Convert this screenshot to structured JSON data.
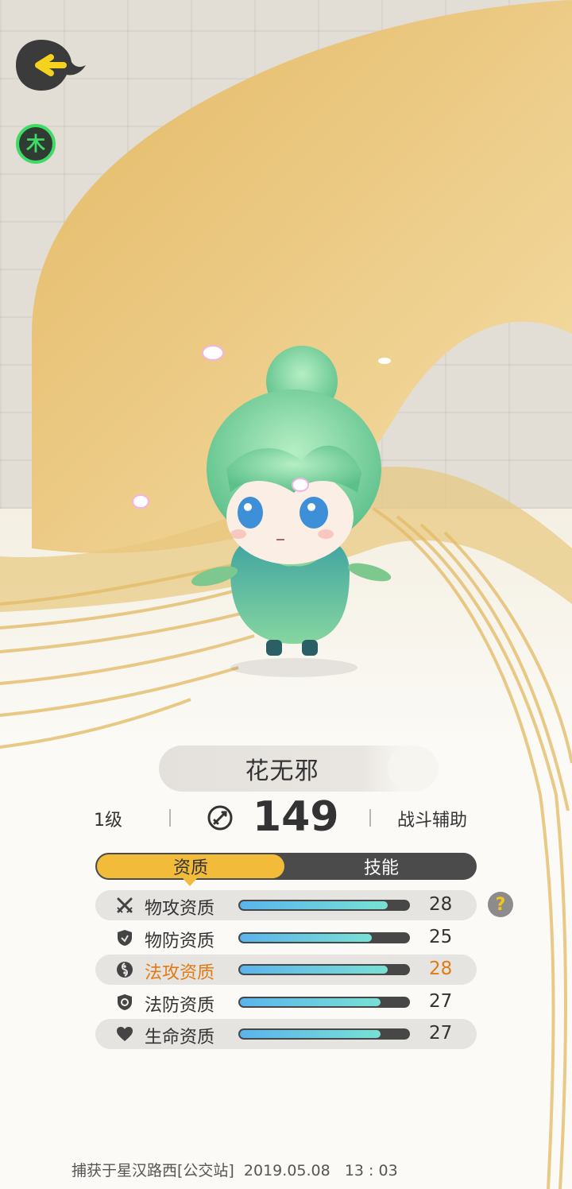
{
  "element_badge": {
    "label": "木"
  },
  "pet": {
    "name": "花无邪",
    "level": "1级",
    "power": "149",
    "role": "战斗辅助"
  },
  "tabs": [
    {
      "label": "资质",
      "active": true
    },
    {
      "label": "技能",
      "active": false
    }
  ],
  "attributes": [
    {
      "label": "物攻资质",
      "value": "28",
      "fill": 0.87,
      "icon": "crossed-swords-icon",
      "highlight": false
    },
    {
      "label": "物防资质",
      "value": "25",
      "fill": 0.78,
      "icon": "shield-icon",
      "highlight": false
    },
    {
      "label": "法攻资质",
      "value": "28",
      "fill": 0.87,
      "icon": "yin-yang-icon",
      "highlight": true
    },
    {
      "label": "法防资质",
      "value": "27",
      "fill": 0.83,
      "icon": "magic-shield-icon",
      "highlight": false
    },
    {
      "label": "生命资质",
      "value": "27",
      "fill": 0.83,
      "icon": "heart-icon",
      "highlight": false
    }
  ],
  "help": {
    "label": "?"
  },
  "footer": {
    "capture_text": "捕获于星汉路西[公交站]",
    "date": "2019.05.08",
    "time": "13 : 03"
  },
  "colors": {
    "accent": "#f2bb3a",
    "element": "#3fdb66",
    "highlight": "#e07b16",
    "bar_start": "#5ab4ec",
    "bar_end": "#78e0d4"
  }
}
